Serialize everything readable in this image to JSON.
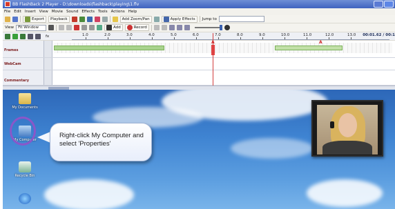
{
  "window": {
    "title": "BB FlashBack 2 Player - D:\\downloads\\flashback\\playing\\1.flv"
  },
  "menu": [
    "File",
    "Edit",
    "Insert",
    "View",
    "Movie",
    "Sound",
    "Effects",
    "Tools",
    "Actions",
    "Help"
  ],
  "toolbar1": {
    "export_label": "Export",
    "playback_label": "Playback",
    "add_zoom_pan_label": "Add Zoom/Pan",
    "apply_effects_label": "Apply Effects",
    "jump_to_label": "Jump to"
  },
  "toolbar2": {
    "view_label": "View",
    "view_value": "Fit Window",
    "add_label": "Add",
    "record_label": "Record"
  },
  "timeline": {
    "ticks": [
      "1.0",
      "2.0",
      "3.0",
      "4.0",
      "5.0",
      "6.0",
      "7.0",
      "8.0",
      "9.0",
      "10.0",
      "11.0",
      "12.0",
      "13.0"
    ],
    "timecode": "00:01.62 / 00:1",
    "fps_label": "fx",
    "tracks": [
      "Frames",
      "WebCam",
      "Commentary"
    ],
    "markers": [
      "A",
      "A"
    ]
  },
  "desktop": {
    "icons": [
      {
        "label": "My Documents",
        "icon": "folder-icon"
      },
      {
        "label": "My Computer",
        "icon": "computer-icon"
      },
      {
        "label": "Recycle Bin",
        "icon": "recycle-bin-icon"
      },
      {
        "label": "",
        "icon": "internet-explorer-icon"
      }
    ],
    "callout_text": "Right-click My Computer and select 'Properties'"
  },
  "colors": {
    "title_bar": "#3f63bf",
    "highlight_circle": "#8a57c9",
    "marker_red": "#e54848",
    "clip_green": "#a9d38d"
  }
}
